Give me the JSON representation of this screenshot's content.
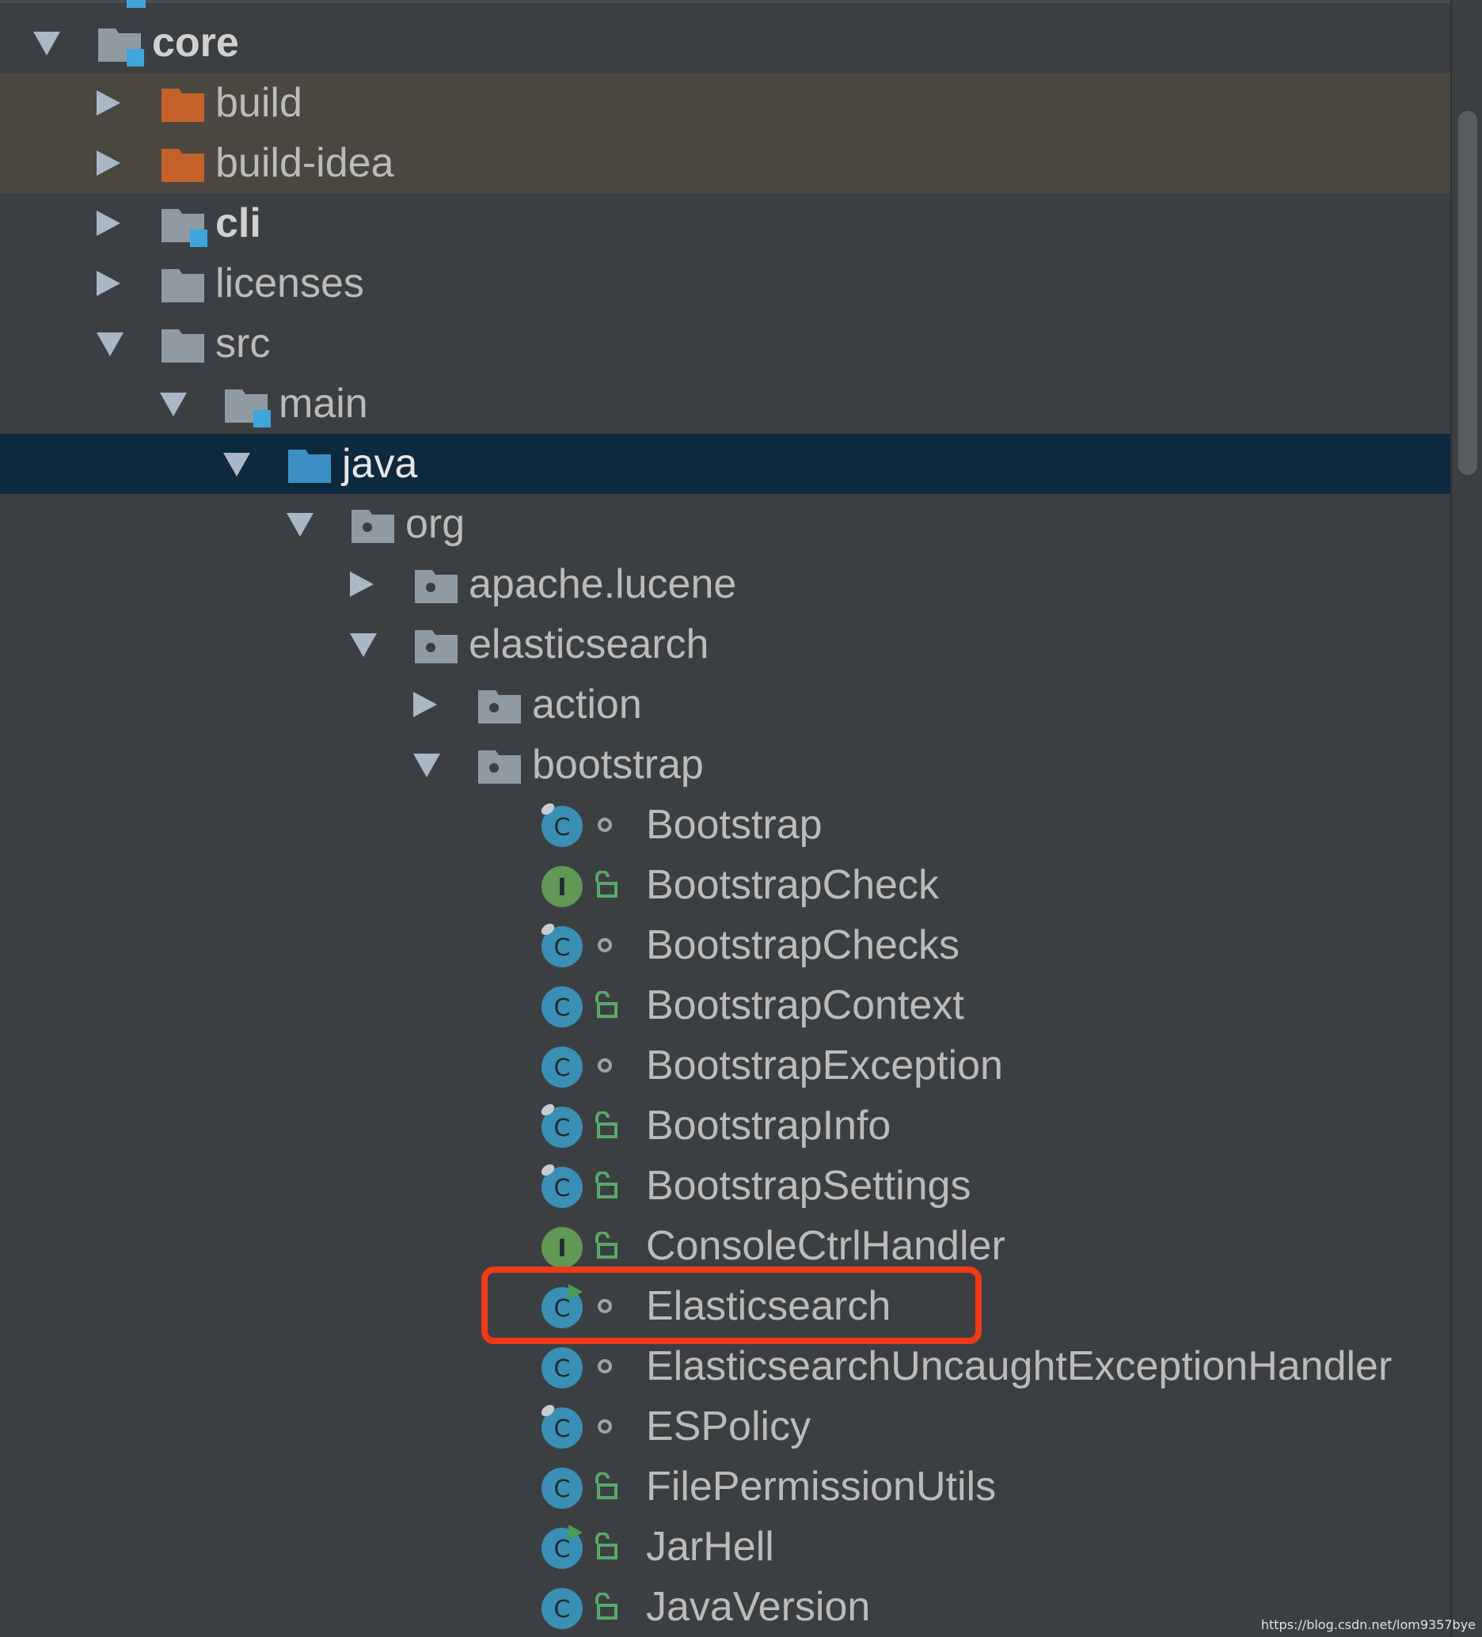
{
  "tree": {
    "rows": [
      {
        "label": "core",
        "depth": 0,
        "expanded": true,
        "icon": "module-folder-icon",
        "bold": true
      },
      {
        "label": "build",
        "depth": 1,
        "expanded": false,
        "icon": "excluded-folder-icon",
        "state": "ignored"
      },
      {
        "label": "build-idea",
        "depth": 1,
        "expanded": false,
        "icon": "excluded-folder-icon",
        "state": "ignored"
      },
      {
        "label": "cli",
        "depth": 1,
        "expanded": false,
        "icon": "module-folder-icon",
        "bold": true
      },
      {
        "label": "licenses",
        "depth": 1,
        "expanded": false,
        "icon": "folder-icon"
      },
      {
        "label": "src",
        "depth": 1,
        "expanded": true,
        "icon": "folder-icon"
      },
      {
        "label": "main",
        "depth": 2,
        "expanded": true,
        "icon": "module-folder-icon"
      },
      {
        "label": "java",
        "depth": 3,
        "expanded": true,
        "icon": "source-root-folder-icon",
        "state": "selected"
      },
      {
        "label": "org",
        "depth": 4,
        "expanded": true,
        "icon": "package-folder-icon"
      },
      {
        "label": "apache.lucene",
        "depth": 5,
        "expanded": false,
        "icon": "package-folder-icon"
      },
      {
        "label": "elasticsearch",
        "depth": 5,
        "expanded": true,
        "icon": "package-folder-icon"
      },
      {
        "label": "action",
        "depth": 6,
        "expanded": false,
        "icon": "package-folder-icon"
      },
      {
        "label": "bootstrap",
        "depth": 6,
        "expanded": true,
        "icon": "package-folder-icon"
      },
      {
        "label": "Bootstrap",
        "depth": 7,
        "kind": "class",
        "mark": "final",
        "visibility": "package"
      },
      {
        "label": "BootstrapCheck",
        "depth": 7,
        "kind": "interface",
        "visibility": "public"
      },
      {
        "label": "BootstrapChecks",
        "depth": 7,
        "kind": "class",
        "mark": "final",
        "visibility": "package"
      },
      {
        "label": "BootstrapContext",
        "depth": 7,
        "kind": "class",
        "visibility": "public"
      },
      {
        "label": "BootstrapException",
        "depth": 7,
        "kind": "class",
        "visibility": "package"
      },
      {
        "label": "BootstrapInfo",
        "depth": 7,
        "kind": "class",
        "mark": "final",
        "visibility": "public"
      },
      {
        "label": "BootstrapSettings",
        "depth": 7,
        "kind": "class",
        "mark": "final",
        "visibility": "public"
      },
      {
        "label": "ConsoleCtrlHandler",
        "depth": 7,
        "kind": "interface",
        "visibility": "public"
      },
      {
        "label": "Elasticsearch",
        "depth": 7,
        "kind": "class",
        "mark": "run",
        "visibility": "package",
        "highlighted": true
      },
      {
        "label": "ElasticsearchUncaughtExceptionHandler",
        "depth": 7,
        "kind": "class",
        "visibility": "package"
      },
      {
        "label": "ESPolicy",
        "depth": 7,
        "kind": "class",
        "mark": "final",
        "visibility": "package"
      },
      {
        "label": "FilePermissionUtils",
        "depth": 7,
        "kind": "class",
        "visibility": "public"
      },
      {
        "label": "JarHell",
        "depth": 7,
        "kind": "class",
        "mark": "run",
        "visibility": "public"
      },
      {
        "label": "JavaVersion",
        "depth": 7,
        "kind": "class",
        "visibility": "public"
      }
    ]
  },
  "watermark": "https://blog.csdn.net/lom9357bye",
  "colors": {
    "background": "#3c3f41",
    "selected_row": "#0d293e",
    "ignored_row": "#4a4740",
    "folder_gray": "#8f9aa3",
    "excluded_orange": "#c4612a",
    "source_blue": "#3c8fc4",
    "module_blue": "#3fa5dd",
    "class_blue": "#3a8fb5",
    "interface_green": "#629755",
    "lock_green": "#59a869",
    "run_green": "#499c54",
    "highlight_red": "#f03a17"
  }
}
